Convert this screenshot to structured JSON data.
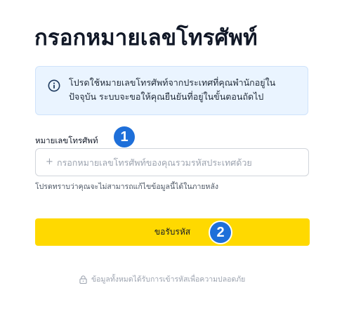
{
  "page": {
    "title": "กรอกหมายเลขโทรศัพท์"
  },
  "info": {
    "icon": "info-circle-icon",
    "text": "โปรดใช้หมายเลขโทรศัพท์จากประเทศที่คุณพำนักอยู่ใน ปัจจุบัน ระบบจะขอให้คุณยืนยันที่อยู่ในขั้นตอนถัดไป"
  },
  "phone": {
    "label": "หมายเลขโทรศัพท์",
    "prefix": "+",
    "placeholder": "กรอกหมายเลขโทรศัพท์ของคุณรวมรหัสประเทศด้วย",
    "value": "",
    "helper": "โปรดทราบว่าคุณจะไม่สามารถแก้ไขข้อมูลนี้ได้ในภายหลัง"
  },
  "actions": {
    "submit_label": "ขอรับรหัส"
  },
  "security": {
    "icon": "lock-icon",
    "note": "ข้อมูลทั้งหมดได้รับการเข้ารหัสเพื่อความปลอดภัย"
  },
  "annotations": {
    "badge_1": "1",
    "badge_2": "2",
    "badge_color": "#1e6fd9"
  },
  "colors": {
    "button": "#ffd900",
    "info_bg": "#eaf4ff",
    "info_icon": "#1e3a5f"
  }
}
